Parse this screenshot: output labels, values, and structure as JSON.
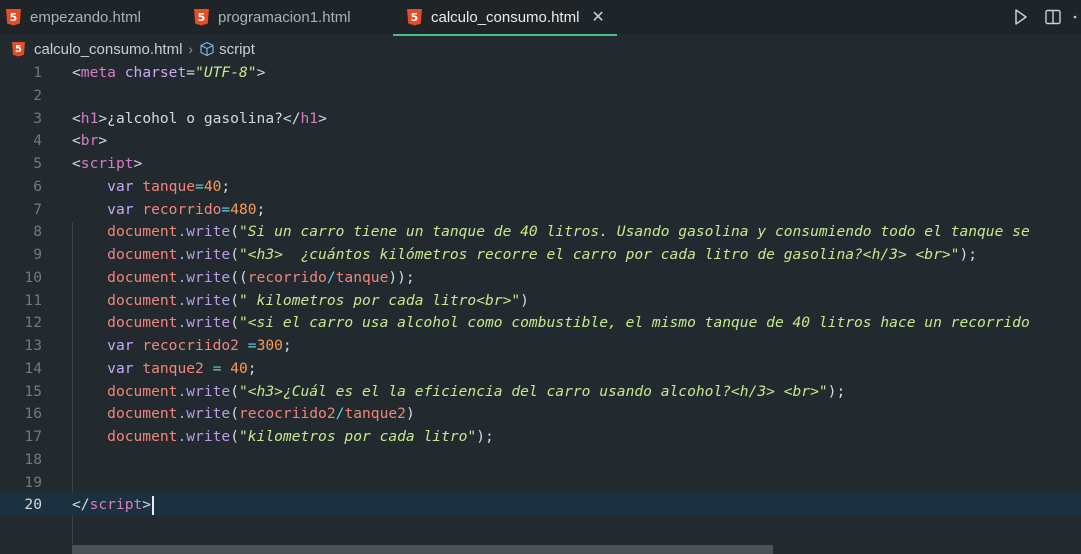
{
  "tabs": [
    {
      "label": "empezando.html",
      "icon": "html5-icon",
      "active": false
    },
    {
      "label": "programacion1.html",
      "icon": "html5-icon",
      "active": false
    },
    {
      "label": "calculo_consumo.html",
      "icon": "html5-icon",
      "active": true
    }
  ],
  "actions": {
    "run": "play-icon",
    "split": "split-editor-icon",
    "more": "more-icon"
  },
  "breadcrumb": {
    "file": "calculo_consumo.html",
    "symbol": "script"
  },
  "editor": {
    "current_line": 20,
    "lines": [
      {
        "n": "1",
        "tokens": [
          [
            "punc",
            "<"
          ],
          [
            "tag",
            "meta"
          ],
          [
            "plain",
            " "
          ],
          [
            "attr",
            "charset"
          ],
          [
            "punc",
            "="
          ],
          [
            "str",
            "\"UTF-8\""
          ],
          [
            "punc",
            ">"
          ]
        ]
      },
      {
        "n": "2",
        "tokens": []
      },
      {
        "n": "3",
        "tokens": [
          [
            "punc",
            "<"
          ],
          [
            "tag",
            "h1"
          ],
          [
            "punc",
            ">"
          ],
          [
            "plain",
            "¿alcohol o gasolina?"
          ],
          [
            "punc",
            "</"
          ],
          [
            "tag",
            "h1"
          ],
          [
            "punc",
            ">"
          ]
        ]
      },
      {
        "n": "4",
        "tokens": [
          [
            "punc",
            "<"
          ],
          [
            "tag",
            "br"
          ],
          [
            "punc",
            ">"
          ]
        ]
      },
      {
        "n": "5",
        "tokens": [
          [
            "punc",
            "<"
          ],
          [
            "tag",
            "script"
          ],
          [
            "punc",
            ">"
          ]
        ]
      },
      {
        "n": "6",
        "tokens": [
          [
            "plain",
            "    "
          ],
          [
            "kw",
            "var"
          ],
          [
            "plain",
            " "
          ],
          [
            "var",
            "tanque"
          ],
          [
            "op",
            "="
          ],
          [
            "num",
            "40"
          ],
          [
            "plain",
            ";"
          ]
        ]
      },
      {
        "n": "7",
        "tokens": [
          [
            "plain",
            "    "
          ],
          [
            "kw",
            "var"
          ],
          [
            "plain",
            " "
          ],
          [
            "var",
            "recorrido"
          ],
          [
            "op",
            "="
          ],
          [
            "num",
            "480"
          ],
          [
            "plain",
            ";"
          ]
        ]
      },
      {
        "n": "8",
        "tokens": [
          [
            "plain",
            "    "
          ],
          [
            "obj",
            "document"
          ],
          [
            "dot",
            "."
          ],
          [
            "fn",
            "write"
          ],
          [
            "plain",
            "("
          ],
          [
            "str",
            "\"Si un carro tiene un tanque de 40 litros. Usando gasolina y consumiendo todo el tanque se"
          ]
        ]
      },
      {
        "n": "9",
        "tokens": [
          [
            "plain",
            "    "
          ],
          [
            "obj",
            "document"
          ],
          [
            "dot",
            "."
          ],
          [
            "fn",
            "write"
          ],
          [
            "plain",
            "("
          ],
          [
            "str",
            "\"<h3>  ¿cuántos kilómetros recorre el carro por cada litro de gasolina?<h/3> <br>\""
          ],
          [
            "plain",
            ");"
          ]
        ]
      },
      {
        "n": "10",
        "tokens": [
          [
            "plain",
            "    "
          ],
          [
            "obj",
            "document"
          ],
          [
            "dot",
            "."
          ],
          [
            "fn",
            "write"
          ],
          [
            "plain",
            "(("
          ],
          [
            "var",
            "recorrido"
          ],
          [
            "op",
            "/"
          ],
          [
            "var",
            "tanque"
          ],
          [
            "plain",
            "));"
          ]
        ]
      },
      {
        "n": "11",
        "tokens": [
          [
            "plain",
            "    "
          ],
          [
            "obj",
            "document"
          ],
          [
            "dot",
            "."
          ],
          [
            "fn",
            "write"
          ],
          [
            "plain",
            "("
          ],
          [
            "str",
            "\" kilometros por cada litro<br>\""
          ],
          [
            "plain",
            ")"
          ]
        ]
      },
      {
        "n": "12",
        "tokens": [
          [
            "plain",
            "    "
          ],
          [
            "obj",
            "document"
          ],
          [
            "dot",
            "."
          ],
          [
            "fn",
            "write"
          ],
          [
            "plain",
            "("
          ],
          [
            "str",
            "\"<si el carro usa alcohol como combustible, el mismo tanque de 40 litros hace un recorrido"
          ]
        ]
      },
      {
        "n": "13",
        "tokens": [
          [
            "plain",
            "    "
          ],
          [
            "kw",
            "var"
          ],
          [
            "plain",
            " "
          ],
          [
            "var",
            "recocriido2"
          ],
          [
            "plain",
            " "
          ],
          [
            "op",
            "="
          ],
          [
            "num",
            "300"
          ],
          [
            "plain",
            ";"
          ]
        ]
      },
      {
        "n": "14",
        "tokens": [
          [
            "plain",
            "    "
          ],
          [
            "kw",
            "var"
          ],
          [
            "plain",
            " "
          ],
          [
            "var",
            "tanque2"
          ],
          [
            "plain",
            " "
          ],
          [
            "op",
            "="
          ],
          [
            "plain",
            " "
          ],
          [
            "num",
            "40"
          ],
          [
            "plain",
            ";"
          ]
        ]
      },
      {
        "n": "15",
        "tokens": [
          [
            "plain",
            "    "
          ],
          [
            "obj",
            "document"
          ],
          [
            "dot",
            "."
          ],
          [
            "fn",
            "write"
          ],
          [
            "plain",
            "("
          ],
          [
            "str",
            "\"<h3>¿Cuál es el la eficiencia del carro usando alcohol?<h/3> <br>\""
          ],
          [
            "plain",
            ");"
          ]
        ]
      },
      {
        "n": "16",
        "tokens": [
          [
            "plain",
            "    "
          ],
          [
            "obj",
            "document"
          ],
          [
            "dot",
            "."
          ],
          [
            "fn",
            "write"
          ],
          [
            "plain",
            "("
          ],
          [
            "var",
            "recocriido2"
          ],
          [
            "op",
            "/"
          ],
          [
            "var",
            "tanque2"
          ],
          [
            "plain",
            ")"
          ]
        ]
      },
      {
        "n": "17",
        "tokens": [
          [
            "plain",
            "    "
          ],
          [
            "obj",
            "document"
          ],
          [
            "dot",
            "."
          ],
          [
            "fn",
            "write"
          ],
          [
            "plain",
            "("
          ],
          [
            "str",
            "\"kilometros por cada litro\""
          ],
          [
            "plain",
            ");"
          ]
        ]
      },
      {
        "n": "18",
        "tokens": []
      },
      {
        "n": "19",
        "tokens": []
      },
      {
        "n": "20",
        "tokens": [
          [
            "punc",
            "</"
          ],
          [
            "tag",
            "script"
          ],
          [
            "punc",
            ">"
          ]
        ]
      }
    ]
  }
}
